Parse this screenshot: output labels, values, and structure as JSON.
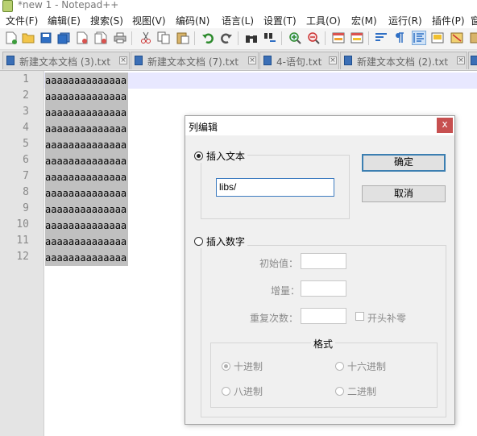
{
  "window": {
    "title": "*new 1 - Notepad++"
  },
  "menu": [
    "文件(F)",
    "编辑(E)",
    "搜索(S)",
    "视图(V)",
    "编码(N)",
    "语言(L)",
    "设置(T)",
    "工具(O)",
    "宏(M)",
    "运行(R)",
    "插件(P)",
    "窗"
  ],
  "toolbar": {
    "buttons": [
      "new-file-icon",
      "open-file-icon",
      "save-icon",
      "save-all-icon",
      "close-icon",
      "close-all-icon",
      "print-icon",
      "cut-icon",
      "copy-icon",
      "paste-icon",
      "undo-icon",
      "redo-icon",
      "find-icon",
      "replace-icon",
      "zoom-in-icon",
      "zoom-out-icon",
      "sync-v-icon",
      "sync-h-icon",
      "word-wrap-icon",
      "show-all-chars-icon",
      "indent-guide-icon",
      "doc-map-icon",
      "function-list-icon"
    ]
  },
  "tabs": [
    {
      "label": "新建文本文档 (3).txt"
    },
    {
      "label": "新建文本文档 (7).txt"
    },
    {
      "label": "4-语句.txt"
    },
    {
      "label": "新建文本文档 (2).txt"
    }
  ],
  "editor": {
    "line_numbers": [
      "1",
      "2",
      "3",
      "4",
      "5",
      "6",
      "7",
      "8",
      "9",
      "10",
      "11",
      "12"
    ],
    "lines": [
      "aaaaaaaaaaaaaa",
      "aaaaaaaaaaaaaa",
      "aaaaaaaaaaaaaa",
      "aaaaaaaaaaaaaa",
      "aaaaaaaaaaaaaa",
      "aaaaaaaaaaaaaa",
      "aaaaaaaaaaaaaa",
      "aaaaaaaaaaaaaa",
      "aaaaaaaaaaaaaa",
      "aaaaaaaaaaaaaa",
      "aaaaaaaaaaaaaa",
      "aaaaaaaaaaaaaa"
    ]
  },
  "dialog": {
    "title": "列编辑",
    "close": "x",
    "insert_text": {
      "label": "插入文本",
      "value": "libs/"
    },
    "ok": "确定",
    "cancel": "取消",
    "insert_number": {
      "label": "插入数字",
      "initial_label": "初始值：",
      "increment_label": "增量：",
      "repeat_label": "重复次数：",
      "leading_zero_label": "开头补零",
      "format_title": "格式",
      "decimal": "十进制",
      "hex": "十六进制",
      "octal": "八进制",
      "binary": "二进制"
    }
  },
  "colors": {
    "tab_icon": "#3b6fb6",
    "selection": "#c0c0c0",
    "close": "#c75050",
    "current_line": "#e8e8ff"
  }
}
